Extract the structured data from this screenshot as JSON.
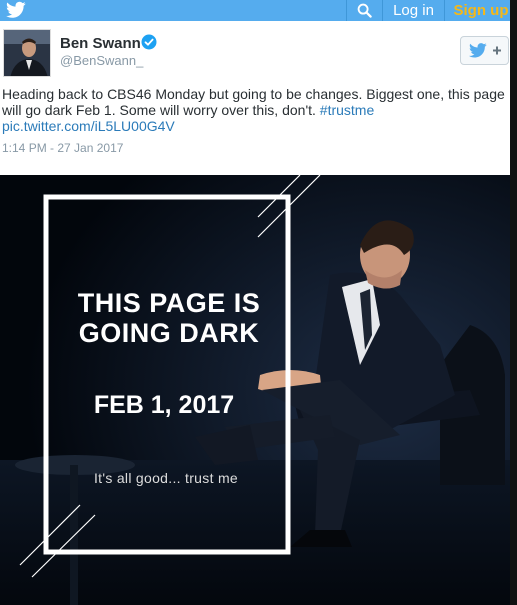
{
  "topbar": {
    "logo_icon": "twitter-bird-icon",
    "search_icon": "search-icon",
    "login_label": "Log in",
    "signup_label": "Sign up",
    "brand_color": "#55acee",
    "signup_color": "#f5b818"
  },
  "tweet": {
    "author_name": "Ben Swann",
    "verified_icon": "verified-badge-icon",
    "handle": "@BenSwann_",
    "follow_icon": "twitter-follow-icon",
    "text_main": "Heading back to CBS46 Monday but going to be changes. Biggest one, this page will go dark Feb 1. Some will worry over this, don't.",
    "hashtag": "#trustme",
    "link": "pic.twitter.com/iL5LU00G4V",
    "timestamp": "1:14 PM - 27 Jan 2017"
  },
  "image": {
    "headline_line1": "THIS PAGE IS",
    "headline_line2": "GOING DARK",
    "date": "FEB 1, 2017",
    "tagline": "It's all good... trust me"
  }
}
